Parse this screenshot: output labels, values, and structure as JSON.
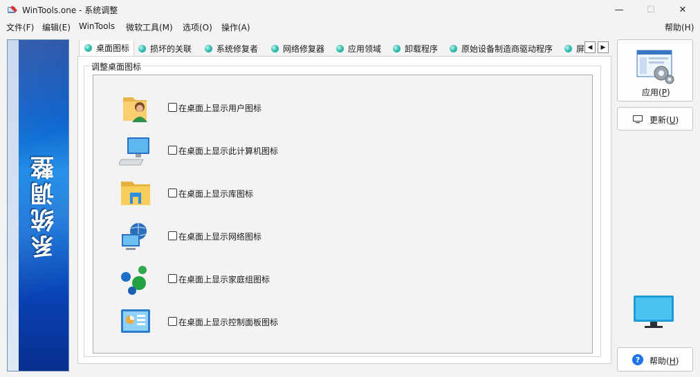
{
  "window": {
    "title": "WinTools.one - 系统调整",
    "minimize_glyph": "—",
    "maximize_glyph": "☐",
    "close_glyph": "✕"
  },
  "menu": {
    "file": "文件(F)",
    "edit": "编辑(E)",
    "wintools": "WinTools",
    "ms_tools": "微软工具(M)",
    "options": "选项(O)",
    "actions": "操作(A)",
    "help": "帮助(H)"
  },
  "side_panel": {
    "title": "系统调整"
  },
  "tabs": [
    {
      "label": "桌面图标",
      "active": true
    },
    {
      "label": "损坏的关联"
    },
    {
      "label": "系统修复者"
    },
    {
      "label": "网络修复器"
    },
    {
      "label": "应用领域"
    },
    {
      "label": "卸载程序"
    },
    {
      "label": "原始设备制造商驱动程序"
    },
    {
      "label": "屏"
    }
  ],
  "tab_scroll": {
    "left": "◀",
    "right": "▶"
  },
  "group": {
    "title": "调整桌面图标"
  },
  "options": [
    {
      "label": "在桌面上显示用户图标",
      "icon": "user-folder-icon",
      "checked": false
    },
    {
      "label": "在桌面上显示此计算机图标",
      "icon": "computer-icon",
      "checked": false
    },
    {
      "label": "在桌面上显示库图标",
      "icon": "library-folder-icon",
      "checked": false
    },
    {
      "label": "在桌面上显示网络图标",
      "icon": "network-icon",
      "checked": false
    },
    {
      "label": "在桌面上显示家庭组图标",
      "icon": "homegroup-icon",
      "checked": false
    },
    {
      "label": "在桌面上显示控制面板图标",
      "icon": "control-panel-icon",
      "checked": false
    }
  ],
  "buttons": {
    "apply_text": "应用(",
    "apply_key": "P",
    "apply_close": ")",
    "update_text": "更新(",
    "update_key": "U",
    "update_close": ")",
    "help_text": "帮助(",
    "help_key": "H",
    "help_close": ")"
  },
  "colors": {
    "side_panel_blue": "#0d5fc9",
    "tab_dot_teal": "#3cc4b5",
    "help_blue": "#1a73e8"
  }
}
